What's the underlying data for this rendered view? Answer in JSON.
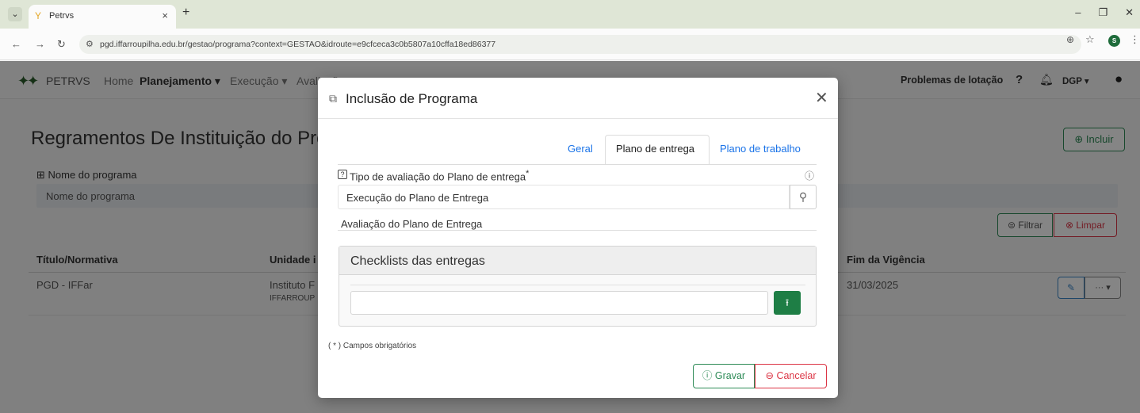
{
  "browser": {
    "tab_title": "Petrvs",
    "url": "pgd.iffarroupilha.edu.br/gestao/programa?context=GESTAO&idroute=e9cfceca3c0b5807a10cffa18ed86377",
    "profile_initial": "S"
  },
  "appbar": {
    "brand": "PETRVS",
    "menu": [
      "Home",
      "Planejamento ▾",
      "Execução ▾",
      "Avaliação"
    ],
    "right_link": "Problemas de lotação",
    "help": "?",
    "user_menu": "DGP ▾"
  },
  "page": {
    "title": "Regramentos De Instituição do Programa",
    "incluir_label": "Incluir",
    "filter_label": "Nome do programa",
    "filter_placeholder": "Nome do programa",
    "filtrar_label": "Filtrar",
    "limpar_label": "Limpar",
    "columns": [
      "Título/Normativa",
      "Unidade i",
      "Fim da Vigência"
    ],
    "rows": [
      {
        "titulo": "PGD - IFFar",
        "unidade": "Instituto F",
        "unidade_sigla": "IFFARROUP",
        "fim": "31/03/2025"
      }
    ]
  },
  "modal": {
    "title": "Inclusão de Programa",
    "tabs": [
      "Geral",
      "Plano de entrega",
      "Plano de trabalho"
    ],
    "active_tab": "Plano de entrega",
    "tipo_label": "Tipo de avaliação do Plano de entrega",
    "required_mark": "*",
    "tipo_value": "Execução do Plano de Entrega",
    "avaliacao_label": "Avaliação do Plano de Entrega",
    "checklist_title": "Checklists das entregas",
    "required_note": "( * ) Campos obrigatórios",
    "gravar_label": "Gravar",
    "cancelar_label": "Cancelar"
  }
}
